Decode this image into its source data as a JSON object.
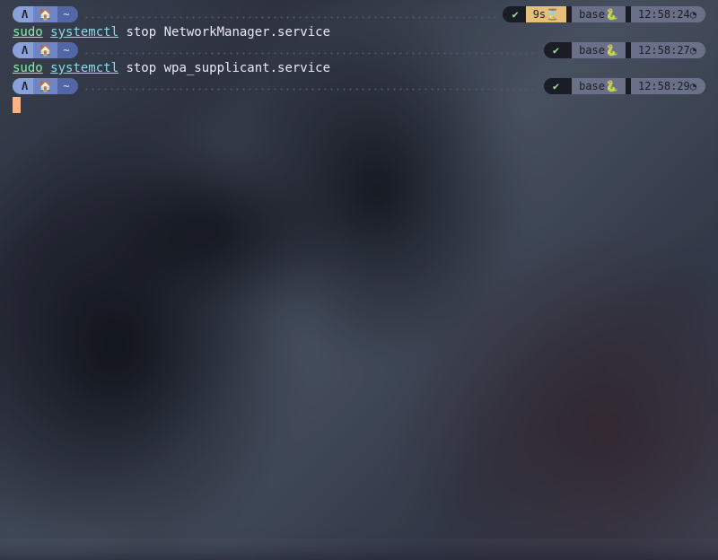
{
  "prompts": [
    {
      "os_icon": "Λ",
      "home_icon": "🏠",
      "path": "~",
      "status_icon": "✔",
      "duration": "9s",
      "dur_icon": "⌛",
      "env": "base",
      "env_icon": "🐍",
      "time": "12:58:24",
      "time_icon": "◔",
      "has_duration": true
    },
    {
      "os_icon": "Λ",
      "home_icon": "🏠",
      "path": "~",
      "status_icon": "✔",
      "env": "base",
      "env_icon": "🐍",
      "time": "12:58:27",
      "time_icon": "◔",
      "has_duration": false
    },
    {
      "os_icon": "Λ",
      "home_icon": "🏠",
      "path": "~",
      "status_icon": "✔",
      "env": "base",
      "env_icon": "🐍",
      "time": "12:58:29",
      "time_icon": "◔",
      "has_duration": false
    }
  ],
  "commands": [
    {
      "sudo": "sudo",
      "prog": "systemctl",
      "args": " stop NetworkManager.service"
    },
    {
      "sudo": "sudo",
      "prog": "systemctl",
      "args": " stop wpa_supplicant.service"
    }
  ]
}
